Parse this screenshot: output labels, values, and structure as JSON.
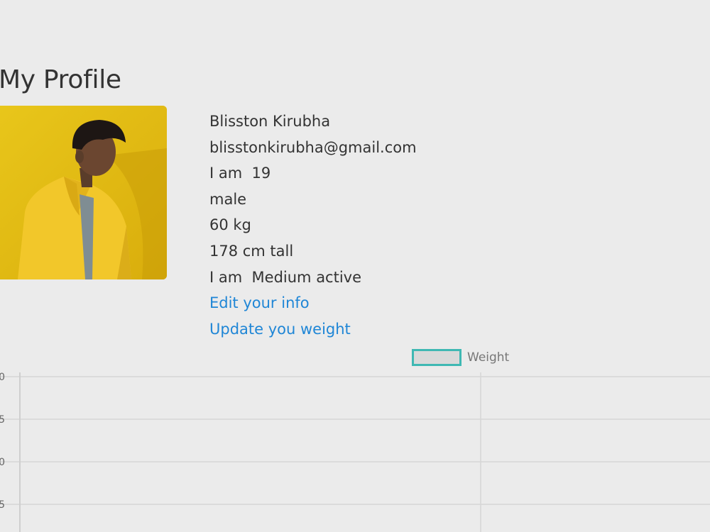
{
  "page": {
    "title": "My Profile"
  },
  "profile": {
    "name": "Blisston Kirubha",
    "email": "blisstonkirubha@gmail.com",
    "age_text": "I am  19",
    "gender": "male",
    "weight": "60 kg",
    "height": "178 cm tall",
    "activity": "I am  Medium active",
    "edit_link": "Edit your info",
    "update_link": "Update you weight"
  },
  "chart_data": {
    "type": "line",
    "legend": [
      {
        "name": "Weight",
        "border_color": "#3fb8b3",
        "fill_color": "#d9d9d9"
      }
    ],
    "legend_position": "top-center",
    "y_tick_labels": [
      "0",
      "5",
      "0",
      "5"
    ],
    "grid": true,
    "series": [
      {
        "name": "Weight",
        "values": []
      }
    ]
  }
}
